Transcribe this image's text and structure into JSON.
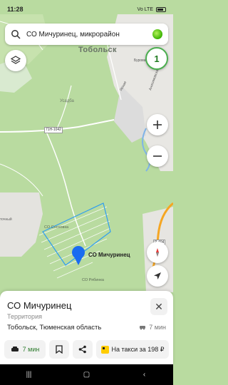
{
  "status_bar": {
    "time": "11:28",
    "indicators": "Vo LTE",
    "battery_level": 0.6
  },
  "search": {
    "query": "СО Мичуринец, микрорайон"
  },
  "map": {
    "city_label": "Тобольск",
    "labels": {
      "usadba": "Усадба",
      "road_code": "71Н-1042",
      "yasnaya": "Ясная",
      "sosnovka": "СО Сосновка",
      "ryabinka": "СО Рябинка",
      "pin_label": "СО Мичуринец",
      "ochny": "точный",
      "anisim": "Анисимовская",
      "burov": "Бурованиях",
      "r404": "Р-404"
    },
    "colors": {
      "forest": "#b9dba0",
      "pin": "#1a6cf0",
      "highlight": "#2e9df0",
      "road_orange": "#f5a623"
    }
  },
  "controls": {
    "badge": "1"
  },
  "place": {
    "title": "СО Мичуринец",
    "type": "Территория",
    "region": "Тобольск, Тюменская область",
    "drive_time": "7 мин"
  },
  "actions": {
    "route_time": "7 мин",
    "taxi": "На такси за 198 ₽"
  }
}
